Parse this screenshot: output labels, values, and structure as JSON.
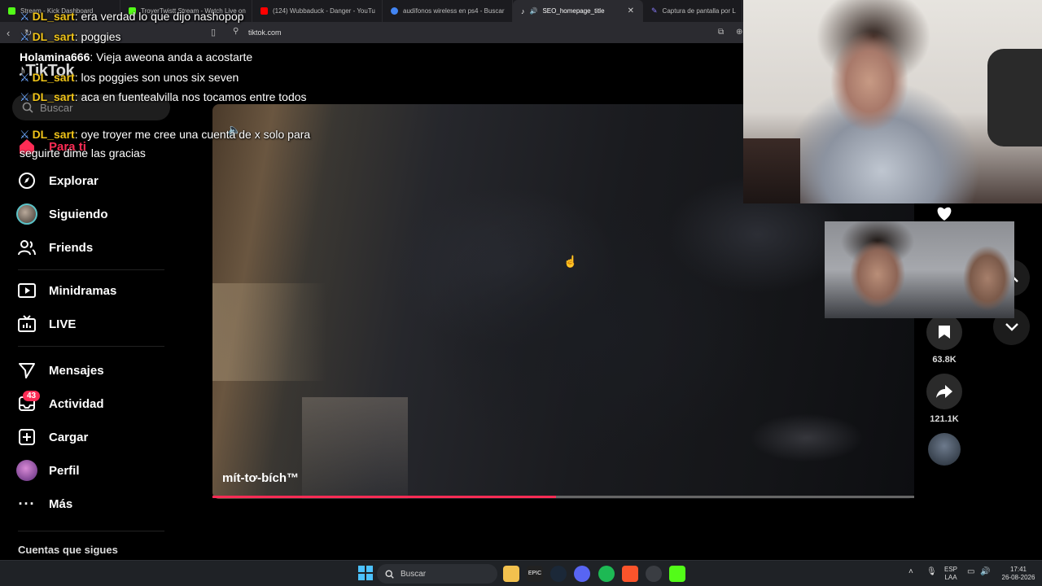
{
  "browser": {
    "tabs": [
      {
        "label": "Stream - Kick Dashboard",
        "color": "#53fc18"
      },
      {
        "label": "TroyerTwistt Stream - Watch Live on",
        "color": "#53fc18"
      },
      {
        "label": "(124) Wubbaduck - Danger - YouTu",
        "color": "#ff0000"
      },
      {
        "label": "audífonos wireless en ps4 - Buscar",
        "color": "#4285f4"
      },
      {
        "label": "SEO_homepage_title",
        "color": "#ffffff"
      },
      {
        "label": "Captura de pantalla por L",
        "color": "#8a7cff"
      }
    ],
    "active_tab_index": 4,
    "url": "tiktok.com"
  },
  "sidebar": {
    "logo": "TikTok",
    "search_placeholder": "Buscar",
    "items": [
      {
        "label": "Para ti",
        "icon": "home-icon"
      },
      {
        "label": "Explorar",
        "icon": "compass-icon"
      },
      {
        "label": "Siguiendo",
        "icon": "avatar-icon"
      },
      {
        "label": "Friends",
        "icon": "friends-icon"
      },
      {
        "label": "Minidramas",
        "icon": "minidramas-icon"
      },
      {
        "label": "LIVE",
        "icon": "live-tv-icon"
      },
      {
        "label": "Mensajes",
        "icon": "send-icon"
      },
      {
        "label": "Actividad",
        "icon": "inbox-icon"
      },
      {
        "label": "Cargar",
        "icon": "upload-icon"
      },
      {
        "label": "Perfil",
        "icon": "profile-avatar-icon"
      },
      {
        "label": "Más",
        "icon": "more-icon"
      }
    ],
    "activity_badge": "43",
    "following_heading": "Cuentas que sigues"
  },
  "video": {
    "caption": "mít-tơ-bích™",
    "progress_fraction": 0.49,
    "bookmarks": "63.8K",
    "shares": "121.1K"
  },
  "chat": [
    {
      "user": "DL_sart",
      "text": "era verdad lo que dijo nashopop",
      "mod": true
    },
    {
      "user": "DL_sart",
      "text": "poggies",
      "mod": true
    },
    {
      "user": "Holamina666",
      "text": "Vieja aweona anda a acostarte",
      "mod": false
    },
    {
      "user": "DL_sart",
      "text": "los poggies son unos six seven",
      "mod": true
    },
    {
      "user": "DL_sart",
      "text": "aca en fuentealvilla nos tocamos entre todos",
      "mod": true
    },
    {
      "user": "DL_sart",
      "text": "oye troyer me cree una cuenta de x solo para seguirte dime las gracias",
      "mod": true
    }
  ],
  "taskbar": {
    "search_placeholder": "Buscar",
    "lang_top": "ESP",
    "lang_bottom": "LAA",
    "time": "17:41",
    "date": "26-08-2026"
  },
  "colors": {
    "accent": "#fe2c55",
    "chat_user": "#f0c419",
    "chat_user_plain": "#ffffff"
  }
}
